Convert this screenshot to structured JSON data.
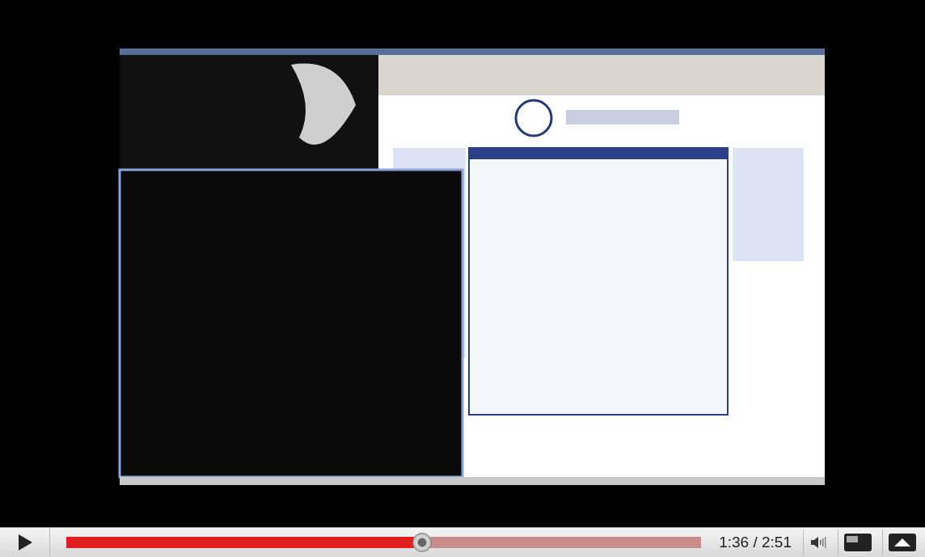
{
  "controls": {
    "playing": false,
    "progress": {
      "level": 0.56
    },
    "time": "1:36 / 2:51"
  }
}
